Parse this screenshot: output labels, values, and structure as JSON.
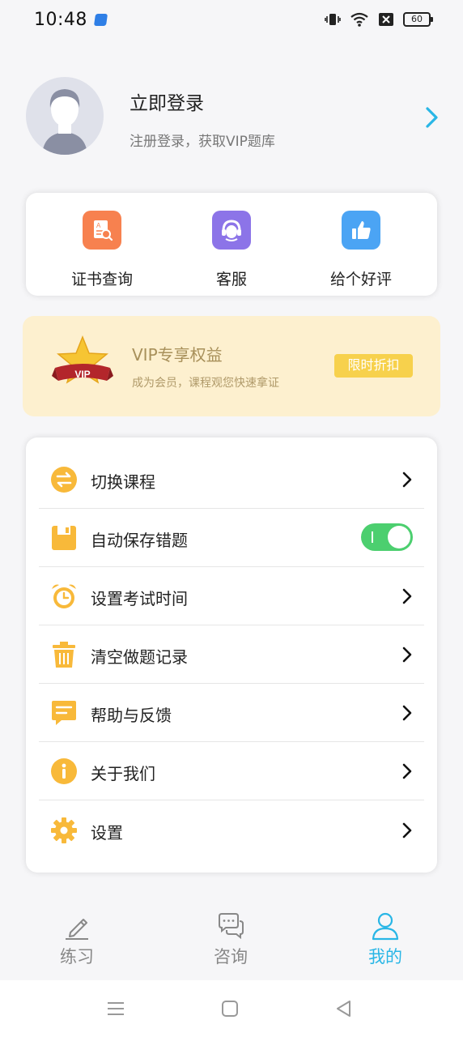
{
  "status_bar": {
    "time": "10:48",
    "battery": "60"
  },
  "profile": {
    "title": "立即登录",
    "subtitle": "注册登录，获取VIP题库"
  },
  "quick_actions": [
    {
      "label": "证书查询",
      "icon": "certificate-search-icon",
      "color": "#f7814f"
    },
    {
      "label": "客服",
      "icon": "customer-service-icon",
      "color": "#8c74e8"
    },
    {
      "label": "给个好评",
      "icon": "thumbs-up-icon",
      "color": "#4ba4f4"
    }
  ],
  "vip": {
    "title": "VIP专享权益",
    "subtitle": "成为会员，课程观您快速拿证",
    "badge_text": "VIP",
    "button_label": "限时折扣"
  },
  "menu": [
    {
      "label": "切换课程",
      "icon": "switch-icon",
      "control": "chevron"
    },
    {
      "label": "自动保存错题",
      "icon": "save-icon",
      "control": "toggle",
      "toggle_on": true
    },
    {
      "label": "设置考试时间",
      "icon": "alarm-clock-icon",
      "control": "chevron"
    },
    {
      "label": "清空做题记录",
      "icon": "trash-icon",
      "control": "chevron"
    },
    {
      "label": "帮助与反馈",
      "icon": "feedback-icon",
      "control": "chevron"
    },
    {
      "label": "关于我们",
      "icon": "info-icon",
      "control": "chevron"
    },
    {
      "label": "设置",
      "icon": "gear-icon",
      "control": "chevron"
    }
  ],
  "tabs": [
    {
      "label": "练习",
      "icon": "pencil-icon",
      "active": false
    },
    {
      "label": "咨询",
      "icon": "chat-icon",
      "active": false
    },
    {
      "label": "我的",
      "icon": "person-icon",
      "active": true
    }
  ],
  "colors": {
    "accent": "#29b6e6",
    "menu_icon": "#f8b93a",
    "toggle_on": "#4ccf6f",
    "vip_button": "#f7d14c"
  }
}
